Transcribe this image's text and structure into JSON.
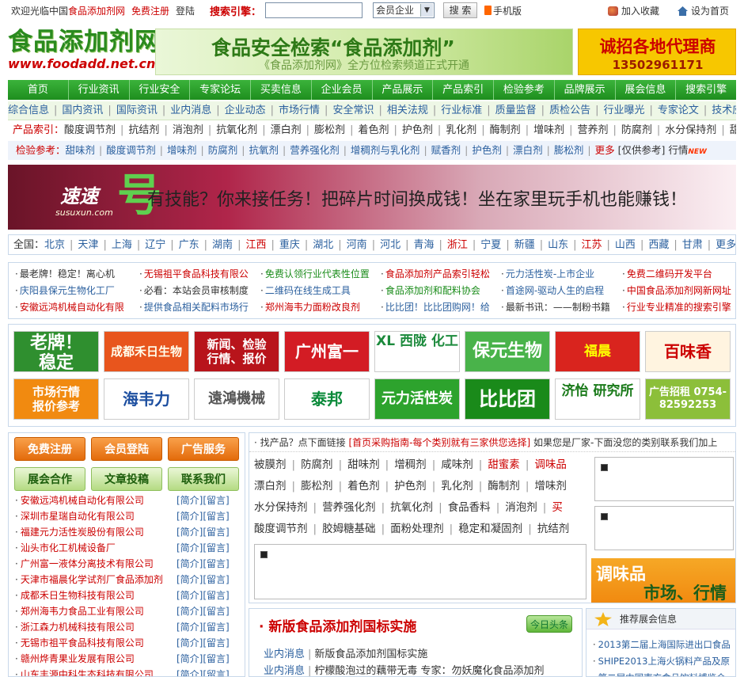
{
  "topbar": {
    "welcome": "欢迎光临中国",
    "site_name": "食品添加剂网",
    "register": "免费注册",
    "login": "登陆",
    "search_label": "搜索引擎：",
    "search_value": "",
    "search_type": "会员企业",
    "search_button": "搜 索",
    "mobile": "手机版",
    "favorite": "加入收藏",
    "homepage": "设为首页"
  },
  "colors": {
    "nav_green": "#1e8e1e",
    "accent_red": "#cc0000",
    "link_blue": "#2a5f9e"
  },
  "logo": {
    "title": "食品添加剂网",
    "url": "www.foodadd.net.cn"
  },
  "banner_top": {
    "title": "食品安全检索“食品添加剂”",
    "subtitle": "《食品添加剂网》全方位检索频道正式开通"
  },
  "agent_banner": {
    "title": "诚招各地代理商",
    "phone": "13502961171"
  },
  "nav": [
    "首页",
    "行业资讯",
    "行业安全",
    "专家论坛",
    "买卖信息",
    "企业会员",
    "产品展示",
    "产品索引",
    "检验参考",
    "品牌展示",
    "展会信息",
    "搜索引擎"
  ],
  "subnav": [
    "综合信息",
    "国内资讯",
    "国际资讯",
    "业内消息",
    "企业动态",
    "市场行情",
    "安全常识",
    "相关法规",
    "行业标准",
    "质量监督",
    "质检公告",
    "行业曝光",
    "专家论文",
    "技术应用"
  ],
  "product_index": {
    "label": "产品索引：",
    "items": [
      "酸度调节剂",
      "抗结剂",
      "消泡剂",
      "抗氧化剂",
      "漂白剂",
      "膨松剂",
      "着色剂",
      "护色剂",
      "乳化剂",
      "酶制剂",
      "增味剂",
      "营养剂",
      "防腐剂",
      "水分保持剂",
      "甜味剂"
    ]
  },
  "inspection": {
    "label": "检验参考：",
    "items": [
      "甜味剂",
      "酸度调节剂",
      "增味剂",
      "防腐剂",
      "抗氧剂",
      "营养强化剂",
      "增稠剂与乳化剂",
      "赋香剂",
      "护色剂",
      "漂白剂",
      "膨松剂"
    ],
    "more": "更多",
    "note": "[仅供参考]",
    "market": "行情",
    "new": "NEW"
  },
  "ad_banner": {
    "brand": "速速",
    "brand_url": "susuxun.com",
    "brand_mark": "号",
    "text": "有技能？你来接任务！把碎片时间换成钱！坐在家里玩手机也能赚钱！"
  },
  "cities": {
    "label": "全国：",
    "items": [
      "北京",
      "天津",
      "上海",
      "辽宁",
      "广东",
      "湖南",
      "江西",
      "重庆",
      "湖北",
      "河南",
      "河北",
      "青海",
      "浙江",
      "宁夏",
      "新疆",
      "山东",
      "江苏",
      "山西",
      "西藏",
      "甘肃"
    ],
    "more": "更多"
  },
  "links": [
    [
      {
        "t": "最老牌！稳定！离心机",
        "c": "dark"
      },
      {
        "t": "无锡祖平食品科技有限公",
        "c": "red"
      },
      {
        "t": "免费认领行业代表性位置",
        "c": "green"
      },
      {
        "t": "食品添加剂产品索引轻松",
        "c": "red"
      },
      {
        "t": "元力活性炭-上市企业",
        "c": "blue"
      },
      {
        "t": "免费二维码开发平台",
        "c": "red"
      }
    ],
    [
      {
        "t": "庆阳县保元生物化工厂",
        "c": "blue"
      },
      {
        "t": "必看：本站会员审核制度",
        "c": "dark"
      },
      {
        "t": "二维码在线生成工具",
        "c": "blue"
      },
      {
        "t": "食品添加剂和配料协会",
        "c": "green"
      },
      {
        "t": "首途网-驱动人生的启程",
        "c": "blue"
      },
      {
        "t": "中国食品添加剂网新网址",
        "c": "red"
      }
    ],
    [
      {
        "t": "安徽远鸿机械自动化有限",
        "c": "red"
      },
      {
        "t": "提供食品相关配料市场行",
        "c": "blue"
      },
      {
        "t": "郑州海韦力面粉改良剂",
        "c": "red"
      },
      {
        "t": "比比团！比比团购网！给",
        "c": "blue"
      },
      {
        "t": "最新书讯：——制粉书籍",
        "c": "dark"
      },
      {
        "t": "行业专业精准的搜索引擎",
        "c": "red"
      }
    ]
  ],
  "logo_tiles": {
    "row1": [
      "老牌！稳定 离心机",
      "成都禾日生物",
      "新闻、检验 行情、报价",
      "广州富一",
      "XL 西陇 化工",
      "保元生物",
      "福晨",
      "百味香"
    ],
    "row2": [
      "市场行情 报价参考",
      "海韦力",
      "遠鴻機械",
      "泰邦",
      "元力活性炭",
      "比比团",
      "济怡 研究所",
      "广告招租 0754-82592253"
    ]
  },
  "left_buttons": [
    "免费注册",
    "会员登陆",
    "广告服务",
    "展会合作",
    "文章投稿",
    "联系我们"
  ],
  "companies": {
    "actions": "[简介][留言]",
    "items": [
      "安徽远鸿机械自动化有限公司",
      "深圳市星瑞自动化有限公司",
      "福建元力活性炭股份有限公司",
      "汕头市化工机械设备厂",
      "广州富一液体分离技术有限公司",
      "天津市福晨化学试剂厂食品添加剂",
      "成都禾日生物科技有限公司",
      "郑州海韦力食品工业有限公司",
      "浙江森力机械科技有限公司",
      "无锡市祖平食品科技有限公司",
      "赣州烨青果业发展有限公司",
      "山东丰源中科生态科技有限公司"
    ]
  },
  "find_product": {
    "prefix": "· 找产品？点下面链接",
    "link": "[首页采购指南-每个类别就有三家供您选择]",
    "suffix": "如果您是厂家-下面没您的类别联系我们加上",
    "rows": [
      [
        "被膜剂",
        "防腐剂",
        "甜味剂",
        "增稠剂",
        "咸味剂",
        "甜蜜素",
        "调味品"
      ],
      [
        "漂白剂",
        "膨松剂",
        "着色剂",
        "护色剂",
        "乳化剂",
        "酶制剂",
        "增味剂"
      ],
      [
        "水分保持剂",
        "营养强化剂",
        "抗氧化剂",
        "食品香料",
        "消泡剂",
        "买"
      ],
      [
        "酸度调节剂",
        "胶姆糖基础",
        "面粉处理剂",
        "稳定和凝固剂",
        "抗结剂"
      ]
    ],
    "red_items": [
      "甜蜜素",
      "调味品",
      "买"
    ]
  },
  "spice_ad": {
    "line1": "调味品",
    "line2": "市场、行情"
  },
  "news": {
    "title": "· 新版食品添加剂国标实施",
    "badge": "今日头条",
    "rows": [
      {
        "cat": "业内消息",
        "text": "新版食品添加剂国标实施"
      },
      {
        "cat": "业内消息",
        "text": "柠檬酸泡过的藕带无毒 专家：勿妖魔化食品添加剂"
      }
    ]
  },
  "expo": {
    "title": "推荐展会信息",
    "items": [
      "2013第二届上海国际进出口食品",
      "SHIPE2013上海火锅料产品及原",
      "第二届中国南方食品饮料博览会"
    ]
  }
}
